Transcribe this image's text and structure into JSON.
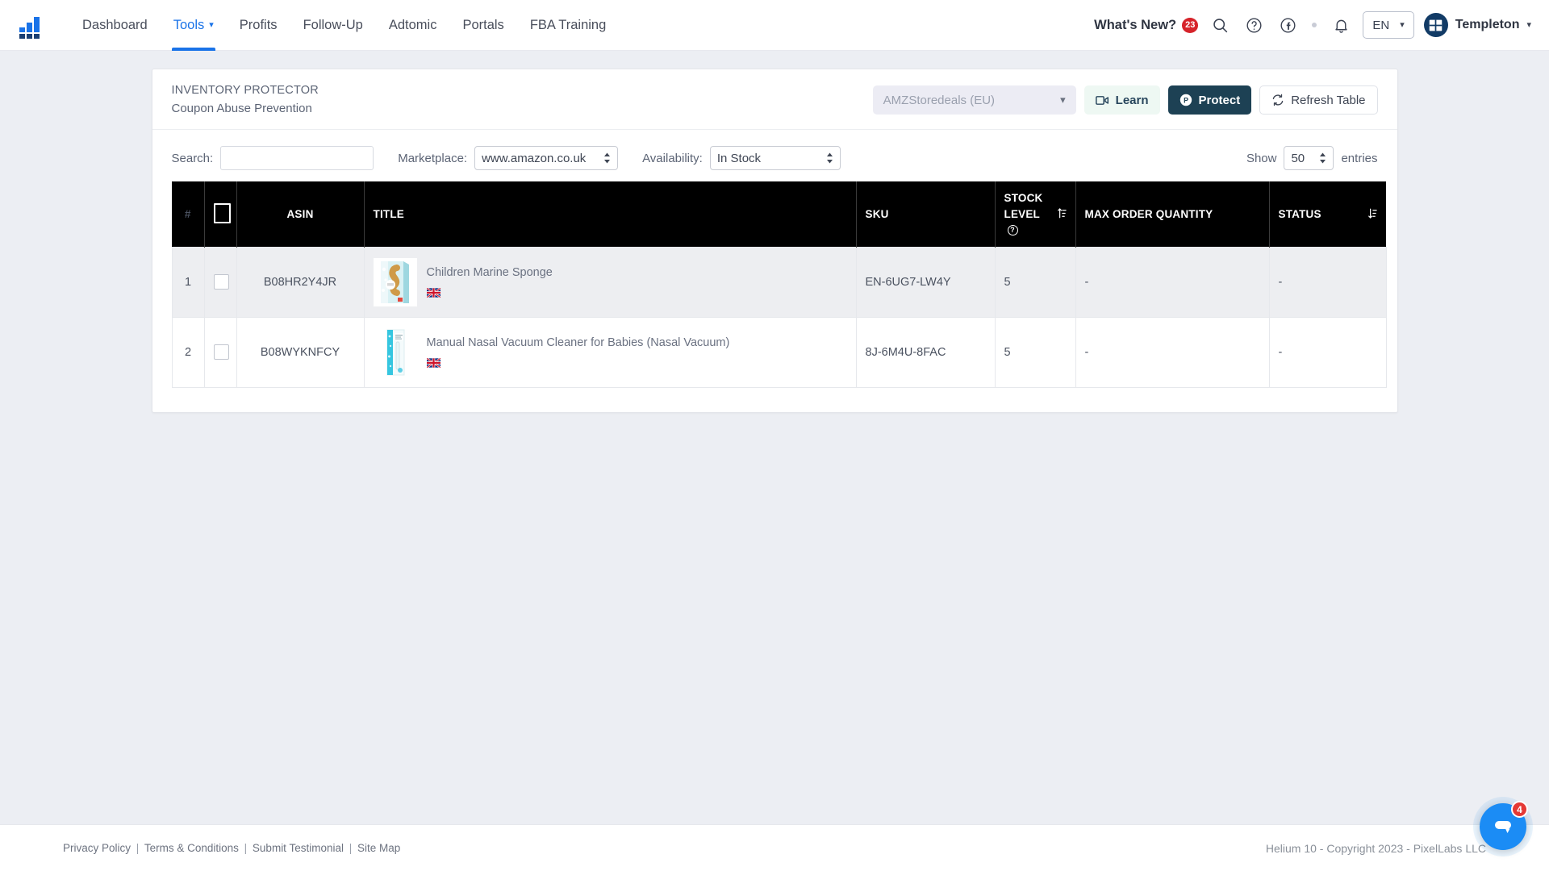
{
  "topnav": {
    "logo_icon": "bar-chart-logo-icon",
    "items": [
      {
        "label": "Dashboard",
        "active": false,
        "caret": false
      },
      {
        "label": "Tools",
        "active": true,
        "caret": true
      },
      {
        "label": "Profits",
        "active": false,
        "caret": false
      },
      {
        "label": "Follow-Up",
        "active": false,
        "caret": false
      },
      {
        "label": "Adtomic",
        "active": false,
        "caret": false
      },
      {
        "label": "Portals",
        "active": false,
        "caret": false
      },
      {
        "label": "FBA Training",
        "active": false,
        "caret": false
      }
    ],
    "whats_new_label": "What's New?",
    "whats_new_count": "23",
    "search_icon": "search-icon",
    "help_icon": "help-circle-icon",
    "facebook_icon": "facebook-icon",
    "bell_icon": "bell-icon",
    "language": "EN",
    "user_name": "Templeton",
    "accent_color": "#1a73e8",
    "avatar_color": "#123b66"
  },
  "panel": {
    "title": "INVENTORY PROTECTOR",
    "subtitle": "Coupon Abuse Prevention",
    "store_value": "AMZStoredeals (EU)",
    "learn_label": "Learn",
    "protect_label": "Protect",
    "refresh_label": "Refresh Table",
    "protect_color": "#1d4154",
    "learn_color": "#eef8f3"
  },
  "controls": {
    "search_label": "Search:",
    "search_value": "",
    "search_placeholder": "",
    "marketplace_label": "Marketplace:",
    "marketplace_value": "www.amazon.co.uk",
    "marketplace_options": [
      "www.amazon.co.uk"
    ],
    "availability_label": "Availability:",
    "availability_value": "In Stock",
    "availability_options": [
      "In Stock"
    ],
    "show_label": "Show",
    "show_value": "50",
    "show_options": [
      "50"
    ],
    "entries_label": "entries"
  },
  "table": {
    "columns": {
      "index": "#",
      "select_all": "",
      "asin": "ASIN",
      "title": "TITLE",
      "sku": "SKU",
      "stock_level_line1": "STOCK",
      "stock_level_line2": "LEVEL",
      "max_order_quantity": "MAX ORDER QUANTITY",
      "status": "STATUS"
    },
    "rows": [
      {
        "index": "1",
        "asin": "B08HR2Y4JR",
        "title": "Children Marine Sponge",
        "flag": "gb-flag-icon",
        "thumb": "product-thumbnail-sponge",
        "sku": "EN-6UG7-LW4Y",
        "stock_level": "5",
        "max_order_quantity": "-",
        "status": "-"
      },
      {
        "index": "2",
        "asin": "B08WYKNFCY",
        "title": "Manual Nasal Vacuum Cleaner for Babies (Nasal Vacuum)",
        "flag": "gb-flag-icon",
        "thumb": "product-thumbnail-nasal-vacuum",
        "sku": "8J-6M4U-8FAC",
        "stock_level": "5",
        "max_order_quantity": "-",
        "status": "-"
      }
    ]
  },
  "footer": {
    "link_privacy": "Privacy Policy",
    "link_terms": "Terms & Conditions",
    "link_testimonial": "Submit Testimonial",
    "link_sitemap": "Site Map",
    "separator": "|",
    "copyright": "Helium 10 - Copyright 2023 - PixelLabs LLC",
    "chat_badge": "4"
  }
}
